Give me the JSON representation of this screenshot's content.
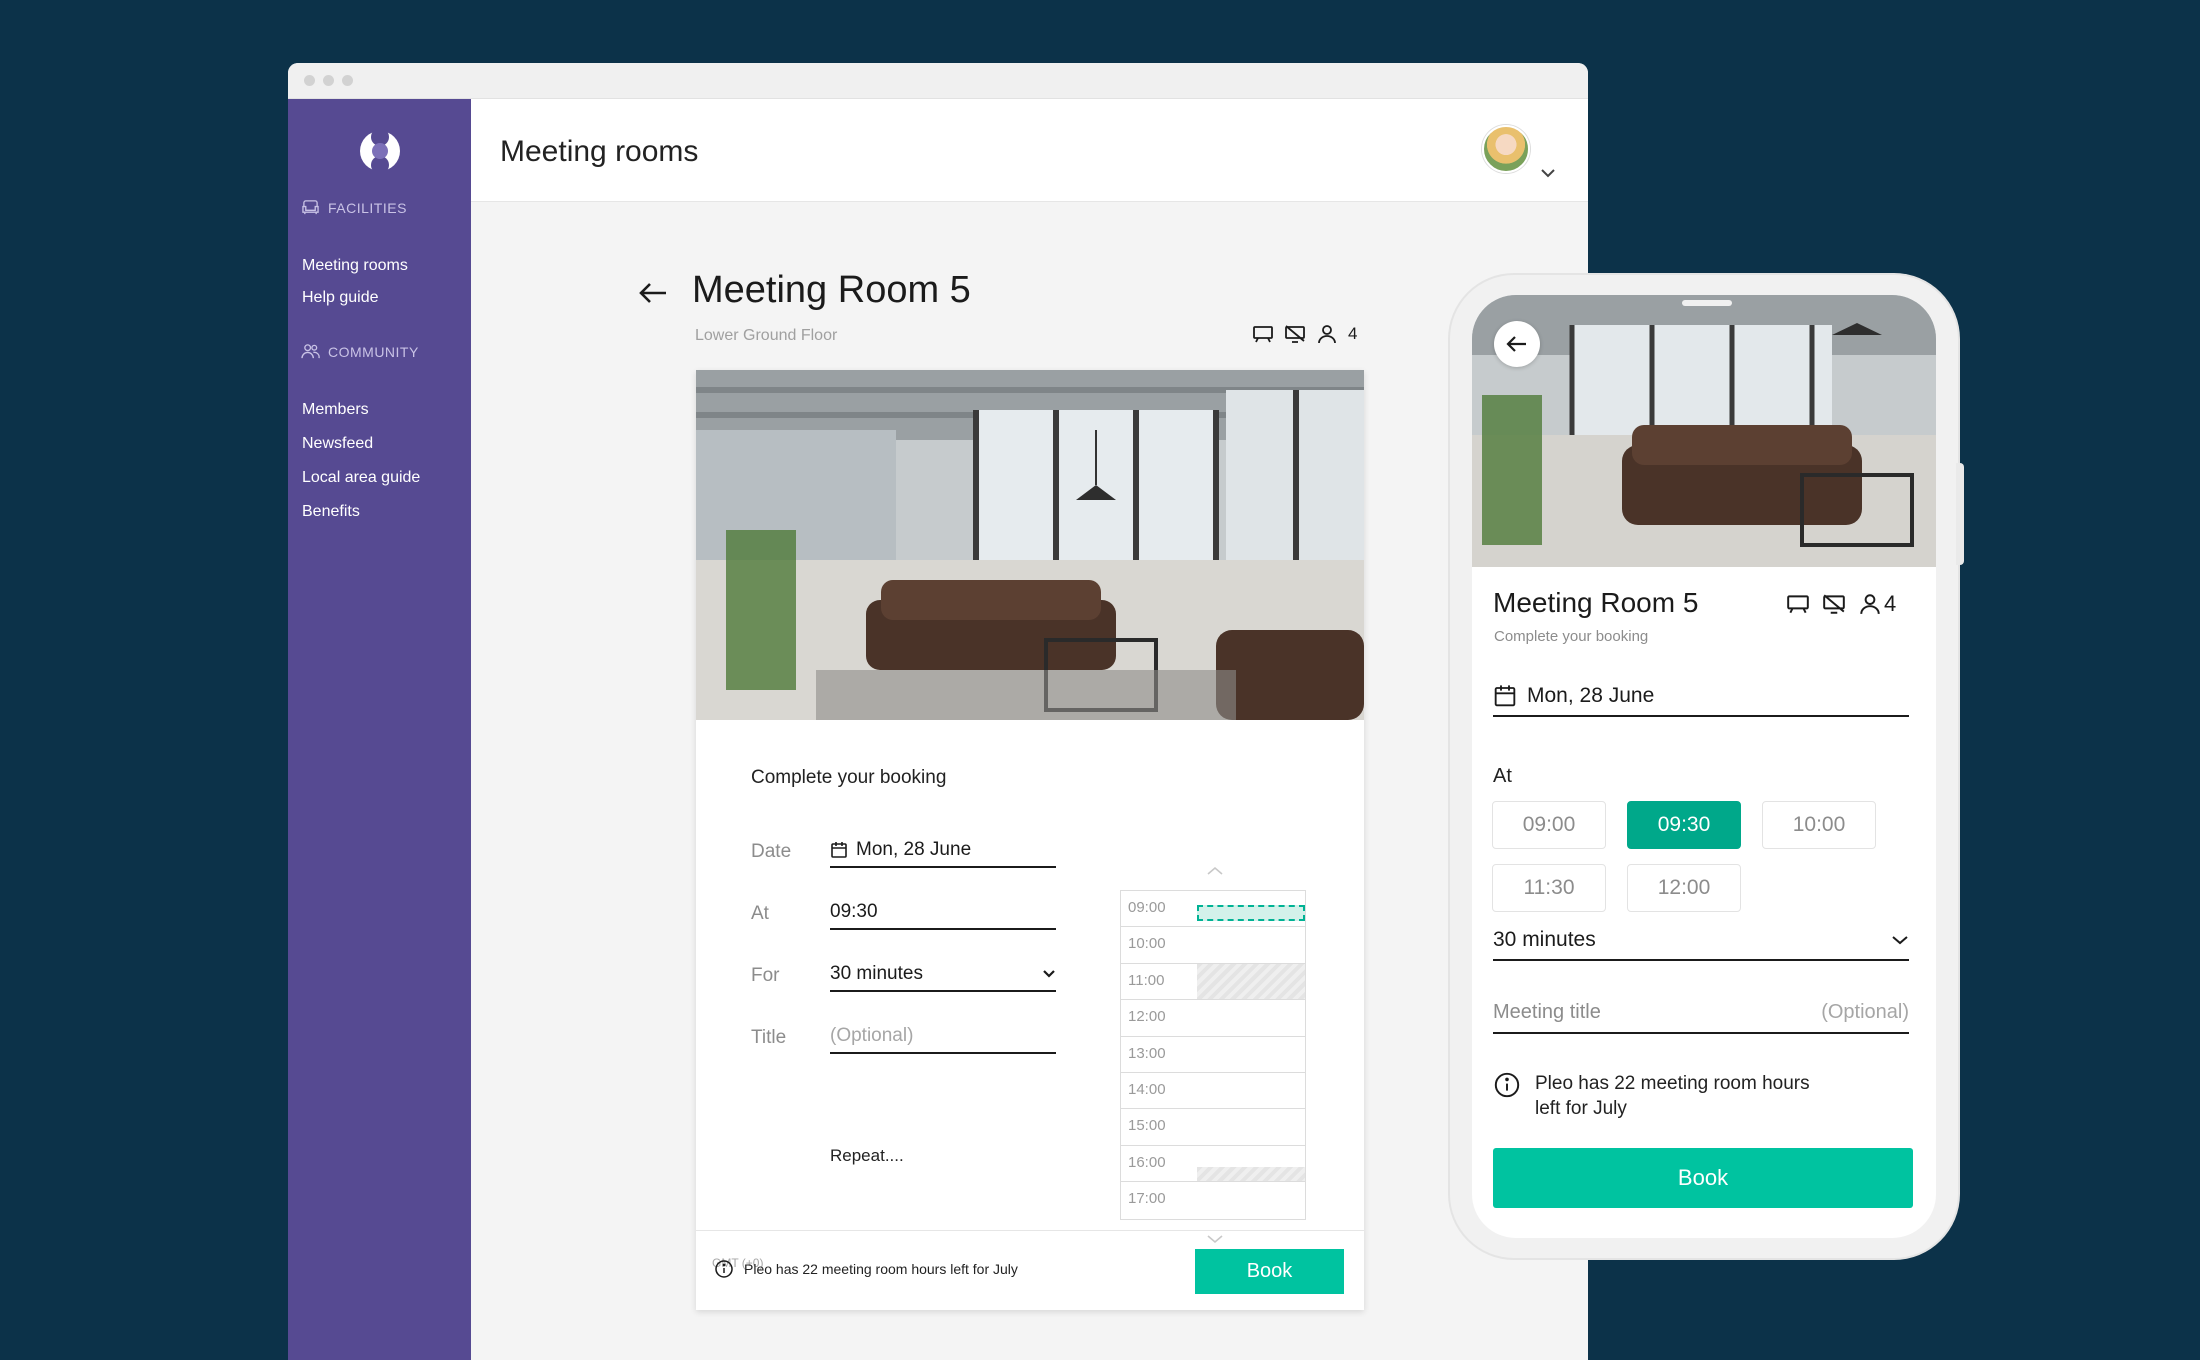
{
  "app": {
    "page_title": "Meeting rooms"
  },
  "sidebar": {
    "sections": [
      {
        "title": "FACILITIES",
        "icon": "armchair-icon",
        "items": [
          "Meeting rooms",
          "Help guide"
        ]
      },
      {
        "title": "COMMUNITY",
        "icon": "people-icon",
        "items": [
          "Members",
          "Newsfeed",
          "Local area guide",
          "Benefits"
        ]
      }
    ]
  },
  "room": {
    "name": "Meeting Room 5",
    "floor": "Lower Ground Floor",
    "capacity": "4",
    "amenity_icons": [
      "whiteboard-icon",
      "no-screen-icon",
      "person-icon"
    ]
  },
  "booking": {
    "heading": "Complete your booking",
    "date_label": "Date",
    "date_value": "Mon, 28 June",
    "at_label": "At",
    "at_value": "09:30",
    "for_label": "For",
    "for_value": "30 minutes",
    "title_label": "Title",
    "title_placeholder": "(Optional)",
    "repeat_label": "Repeat....",
    "timezone": "GMT (+0)",
    "info": "Pleo has 22 meeting room hours left for July",
    "book_label": "Book",
    "timeline_hours": [
      "09:00",
      "10:00",
      "11:00",
      "12:00",
      "13:00",
      "14:00",
      "15:00",
      "16:00",
      "17:00"
    ]
  },
  "mobile": {
    "room_name": "Meeting Room 5",
    "capacity": "4",
    "subtitle": "Complete your booking",
    "date_value": "Mon, 28 June",
    "at_label": "At",
    "slots": [
      "09:00",
      "09:30",
      "10:00",
      "11:30",
      "12:00"
    ],
    "selected_slot": "09:30",
    "duration": "30 minutes",
    "meeting_title_label": "Meeting title",
    "meeting_title_optional": "(Optional)",
    "info": "Pleo has 22 meeting room hours left for July",
    "book_label": "Book"
  },
  "colors": {
    "background": "#0c3249",
    "sidebar": "#564a92",
    "accent": "#00c3a0",
    "slot_active": "#00a88a"
  }
}
